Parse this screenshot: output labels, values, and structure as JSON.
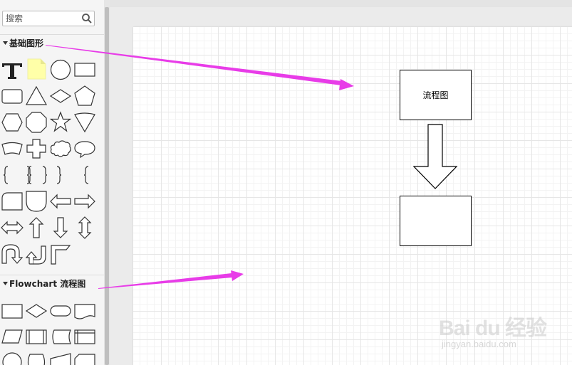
{
  "search": {
    "placeholder": "搜索"
  },
  "sections": {
    "basic_shapes": "基础图形",
    "flowchart": "Flowchart 流程图"
  },
  "basic_shape_icons": [
    "text-icon",
    "note-icon",
    "circle-icon",
    "rectangle-icon",
    "rounded-rectangle-icon",
    "triangle-icon",
    "diamond-icon",
    "pentagon-icon",
    "hexagon-icon",
    "octagon-icon",
    "star-icon",
    "funnel-icon",
    "curved-banner-icon",
    "cross-icon",
    "cloud-icon",
    "speech-bubble-icon",
    "left-brace-icon",
    "double-brace-icon",
    "right-brace-icon",
    "curly-brace-icon",
    "rounded-tab-icon",
    "leaf-shape-icon",
    "left-arrow-icon",
    "right-arrow-icon",
    "left-right-arrow-icon",
    "up-arrow-icon",
    "down-arrow-icon",
    "up-down-arrow-icon",
    "u-turn-down-icon",
    "u-turn-up-icon",
    "corner-arrow-icon"
  ],
  "flowchart_shape_icons": [
    "process-icon",
    "decision-icon",
    "terminator-icon",
    "document-icon",
    "data-icon",
    "predefined-process-icon",
    "stored-data-icon",
    "internal-storage-icon"
  ],
  "canvas": {
    "box1_text": "流程图"
  },
  "colors": {
    "annotation_arrow": "#e83ce8",
    "sidebar_bg": "#f5f5f5",
    "note_fill": "#ffffa8"
  },
  "watermark": {
    "main": "Bai du 经验",
    "sub": "jingyan.baidu.com"
  }
}
